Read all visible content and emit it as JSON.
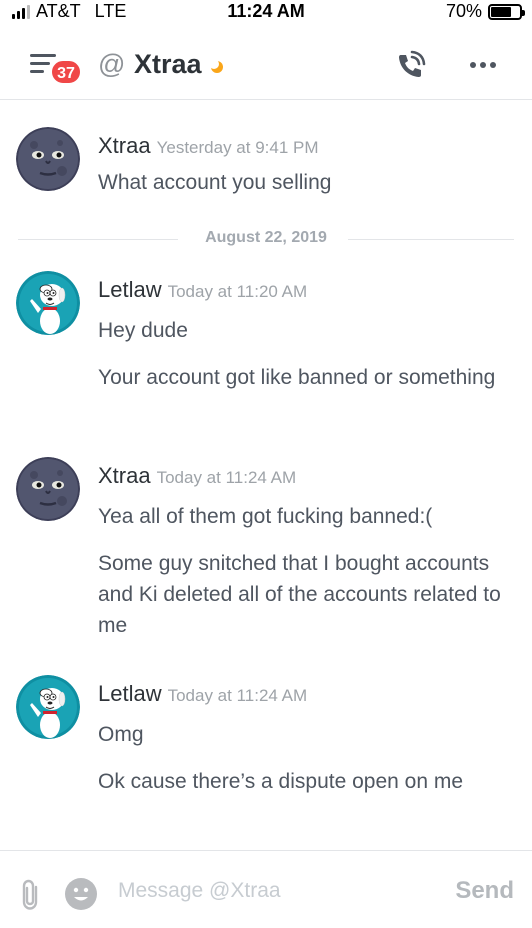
{
  "status_bar": {
    "carrier": "AT&T",
    "network": "LTE",
    "time": "11:24 AM",
    "battery_text": "70%",
    "battery_level": 0.7
  },
  "header": {
    "unread_count": "37",
    "at_symbol": "@",
    "channel_name": "Xtraa",
    "status_color": "#faa61a",
    "menu_icon": "hamburger-icon",
    "call_icon": "phone-call-icon",
    "more_icon": "more-dots-icon"
  },
  "messages": [
    {
      "author": "Xtraa",
      "timestamp": "Yesterday at 9:41 PM",
      "avatar": "moon-face-avatar",
      "lines": [
        "What account you selling"
      ]
    },
    {
      "divider": "August 22, 2019"
    },
    {
      "author": "Letlaw",
      "timestamp": "Today at 11:20 AM",
      "avatar": "white-dog-avatar",
      "lines": [
        "Hey dude",
        "Your account got like banned or something"
      ]
    },
    {
      "author": "Xtraa",
      "timestamp": "Today at 11:24 AM",
      "avatar": "moon-face-avatar",
      "lines": [
        "Yea all of them got fucking banned:(",
        "Some guy snitched that I bought accounts and Ki deleted all of the accounts related to me"
      ]
    },
    {
      "author": "Letlaw",
      "timestamp": "Today at 11:24 AM",
      "avatar": "white-dog-avatar",
      "lines": [
        "Omg",
        "Ok cause there’s a dispute open on me"
      ]
    }
  ],
  "composer": {
    "placeholder": "Message @Xtraa",
    "send_label": "Send",
    "attach_icon": "paperclip-icon",
    "emoji_icon": "emoji-icon"
  },
  "colors": {
    "accent_red": "#f04747",
    "text_primary": "#2e3338",
    "text_secondary": "#4f5660",
    "text_muted": "#9ea3a8",
    "avatar_teal": "#0f8fa2"
  }
}
